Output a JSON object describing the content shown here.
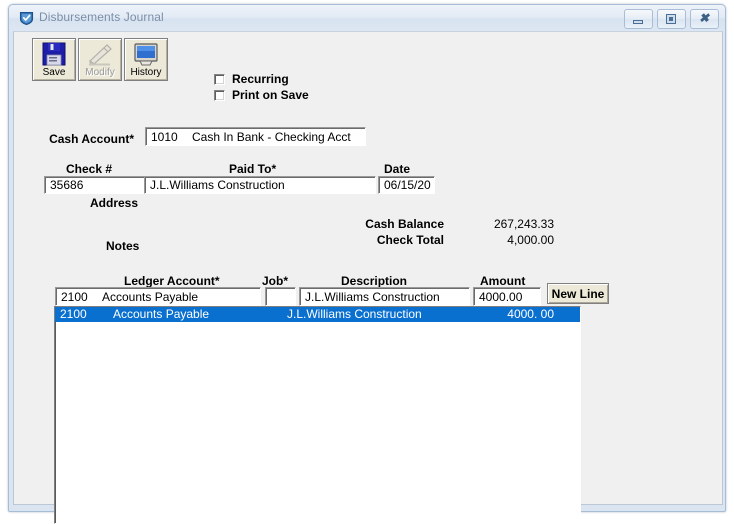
{
  "window": {
    "title": "Disbursements Journal",
    "icon": "app-shield-icon",
    "controls": {
      "minimize": "minimize-icon",
      "maximize": "maximize-icon",
      "close": "close-icon"
    }
  },
  "toolbar": {
    "buttons": [
      {
        "label": "Save",
        "icon": "floppy-disk-icon",
        "enabled": true
      },
      {
        "label": "Modify",
        "icon": "pencil-edit-icon",
        "enabled": false
      },
      {
        "label": "History",
        "icon": "monitor-screen-icon",
        "enabled": true
      }
    ]
  },
  "options": {
    "recurring": {
      "label": "Recurring",
      "checked": false
    },
    "print_on_save": {
      "label": "Print on Save",
      "checked": false
    }
  },
  "form": {
    "cash_account": {
      "label": "Cash Account*",
      "code": "1010",
      "name": "Cash In Bank - Checking Acct"
    },
    "check_number": {
      "label": "Check #",
      "value": "35686"
    },
    "paid_to": {
      "label": "Paid To*",
      "value": "J.L.Williams Construction"
    },
    "date": {
      "label": "Date",
      "value": "06/15/20"
    },
    "address": {
      "label": "Address",
      "value": ""
    },
    "notes": {
      "label": "Notes",
      "value": ""
    }
  },
  "totals": {
    "cash_balance": {
      "label": "Cash Balance",
      "value": "267,243.33"
    },
    "check_total": {
      "label": "Check Total",
      "value": "4,000.00"
    }
  },
  "detail_entry": {
    "headers": {
      "ledger_account": "Ledger Account*",
      "job": "Job*",
      "description": "Description",
      "amount": "Amount"
    },
    "ledger_account_code": "2100",
    "ledger_account_name": "Accounts Payable",
    "job": "",
    "description": "J.L.Williams Construction",
    "amount": "4000.00",
    "new_line_label": "New Line"
  },
  "detail_rows": [
    {
      "account_code": "2100",
      "account_name": "Accounts Payable",
      "description": "J.L.Williams Construction",
      "amount": "4000. 00",
      "selected": true
    }
  ],
  "colors": {
    "selection": "#0a70d0",
    "window_frame": "#dbe5f1",
    "client_bg": "#f0f0f0",
    "title_text": "#7b8fa8",
    "save_icon": "#1d1da8"
  }
}
